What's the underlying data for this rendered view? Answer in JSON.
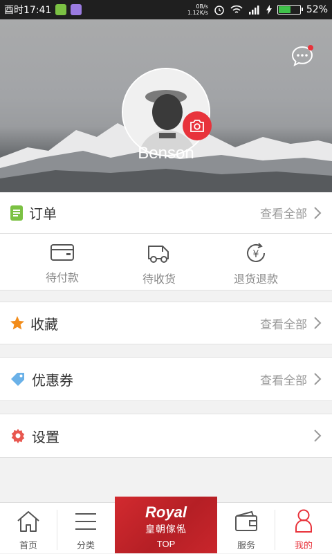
{
  "status_bar": {
    "time": "酉时17:41",
    "net_speed_up": "0B/s",
    "net_speed_down": "1.12K/s",
    "battery": "52%",
    "battery_level": 0.52
  },
  "profile": {
    "username": "Benson"
  },
  "orders": {
    "title": "订单",
    "view_all": "查看全部",
    "items": [
      {
        "label": "待付款"
      },
      {
        "label": "待收货"
      },
      {
        "label": "退货退款"
      }
    ]
  },
  "favorites": {
    "title": "收藏",
    "view_all": "查看全部"
  },
  "coupons": {
    "title": "优惠券",
    "view_all": "查看全部"
  },
  "settings": {
    "title": "设置"
  },
  "tabbar": {
    "home": "首页",
    "category": "分类",
    "brand_en": "Royal",
    "brand_cn": "皇朝傢俬",
    "top": "TOP",
    "service": "服务",
    "mine": "我的"
  },
  "colors": {
    "accent": "#e8333b",
    "orange": "#f28c1a",
    "green": "#7bc143",
    "blue": "#6ab1e8"
  }
}
